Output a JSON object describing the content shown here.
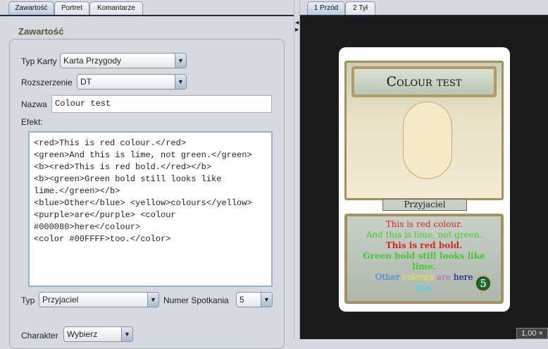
{
  "left_tabs": [
    "Zawartość",
    "Portret",
    "Komantarze"
  ],
  "section_title": "Zawartość",
  "form": {
    "typ_karty_label": "Typ Karty",
    "typ_karty_value": "Karta Przygody",
    "rozszerzenie_label": "Rozszerzenie",
    "rozszerzenie_value": "DT",
    "nazwa_label": "Nazwa",
    "nazwa_value": "Colour test",
    "efekt_label": "Efekt:",
    "efekt_lines": [
      "<red>This is red colour.</red>",
      "<green>And this is lime, not green.</green>",
      "<b><red>This is red bold.</red></b>",
      "<b><green>Green bold still looks like",
      "lime.</green></b>",
      "<blue>Other</blue> <yellow>colours</yellow>",
      "<purple>are</purple> <colour",
      "#000080>here</colour>",
      "<color #00FFFF>too.</color>"
    ],
    "typ_label": "Typ",
    "typ_value": "Przyjaciel",
    "numer_label": "Numer Spotkania",
    "numer_value": "5",
    "charakter_label": "Charakter",
    "charakter_value": "Wybierz"
  },
  "right_tabs": [
    "1 Przód",
    "2 Tył"
  ],
  "card": {
    "title": "Colour test",
    "subtitle": "Przyjaciel",
    "number": "5",
    "text": {
      "l1": "This is red colour.",
      "l2": "And this is lime, not green.",
      "l3": "This is red bold.",
      "l4": "Green bold still looks like",
      "l5": "lime.",
      "other": "Other",
      "colours": "colours",
      "are": "are",
      "here": "here",
      "too": "too."
    }
  },
  "zoom_level": "1,00 ×"
}
